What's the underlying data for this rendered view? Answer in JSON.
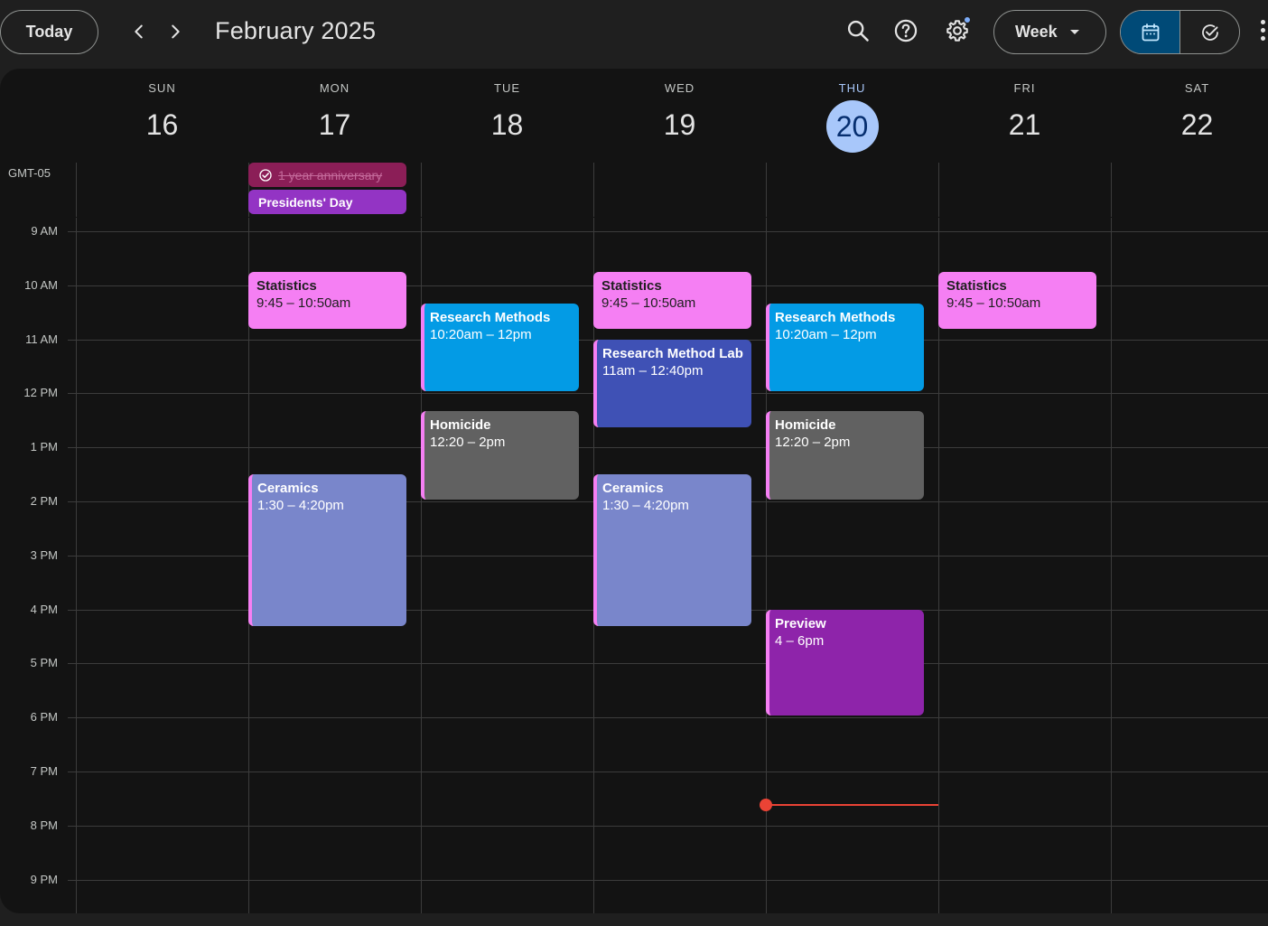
{
  "header": {
    "today_label": "Today",
    "month_title": "February 2025",
    "view_label": "Week"
  },
  "colors": {
    "accent": "#a8c7fa",
    "statistics": "#f57ff3",
    "research_methods": "#039be5",
    "research_lab": "#3f51b5",
    "homicide": "#616161",
    "ceramics": "#7986cb",
    "preview": "#8e24aa",
    "now_indicator": "#ea4335"
  },
  "icons": {
    "prev": "chevron-left-icon",
    "next": "chevron-right-icon",
    "search": "search-icon",
    "help": "help-icon",
    "settings": "gear-icon",
    "calendar": "calendar-icon",
    "tasks": "check-circle-icon",
    "more": "more-vert-icon"
  },
  "timezone": "GMT-05",
  "days": [
    {
      "name": "SUN",
      "num": "16"
    },
    {
      "name": "MON",
      "num": "17"
    },
    {
      "name": "TUE",
      "num": "18"
    },
    {
      "name": "WED",
      "num": "19"
    },
    {
      "name": "THU",
      "num": "20"
    },
    {
      "name": "FRI",
      "num": "21"
    },
    {
      "name": "SAT",
      "num": "22"
    }
  ],
  "today_index": 4,
  "hours": [
    "9 AM",
    "10 AM",
    "11 AM",
    "12 PM",
    "1 PM",
    "2 PM",
    "3 PM",
    "4 PM",
    "5 PM",
    "6 PM",
    "7 PM",
    "8 PM",
    "9 PM"
  ],
  "all_day": [
    {
      "day": 1,
      "title": "1 year anniversary",
      "kind": "anniv"
    },
    {
      "day": 1,
      "title": "Presidents' Day",
      "kind": "presidents"
    }
  ],
  "events": [
    {
      "day": 1,
      "title": "Statistics",
      "time": "9:45 – 10:50am",
      "color": "pink"
    },
    {
      "day": 1,
      "title": "Ceramics",
      "time": "1:30 – 4:20pm",
      "color": "lavender"
    },
    {
      "day": 2,
      "title": "Research Methods",
      "time": "10:20am – 12pm",
      "color": "blue"
    },
    {
      "day": 2,
      "title": "Homicide",
      "time": "12:20 – 2pm",
      "color": "gray"
    },
    {
      "day": 3,
      "title": "Statistics",
      "time": "9:45 – 10:50am",
      "color": "pink"
    },
    {
      "day": 3,
      "title": "Research Method Lab",
      "time": "11am – 12:40pm",
      "color": "indigo"
    },
    {
      "day": 3,
      "title": "Ceramics",
      "time": "1:30 – 4:20pm",
      "color": "lavender"
    },
    {
      "day": 4,
      "title": "Research Methods",
      "time": "10:20am – 12pm",
      "color": "blue"
    },
    {
      "day": 4,
      "title": "Homicide",
      "time": "12:20 – 2pm",
      "color": "gray"
    },
    {
      "day": 4,
      "title": "Preview",
      "time": "4 – 6pm",
      "color": "purple"
    },
    {
      "day": 5,
      "title": "Statistics",
      "time": "9:45 – 10:50am",
      "color": "pink"
    }
  ]
}
